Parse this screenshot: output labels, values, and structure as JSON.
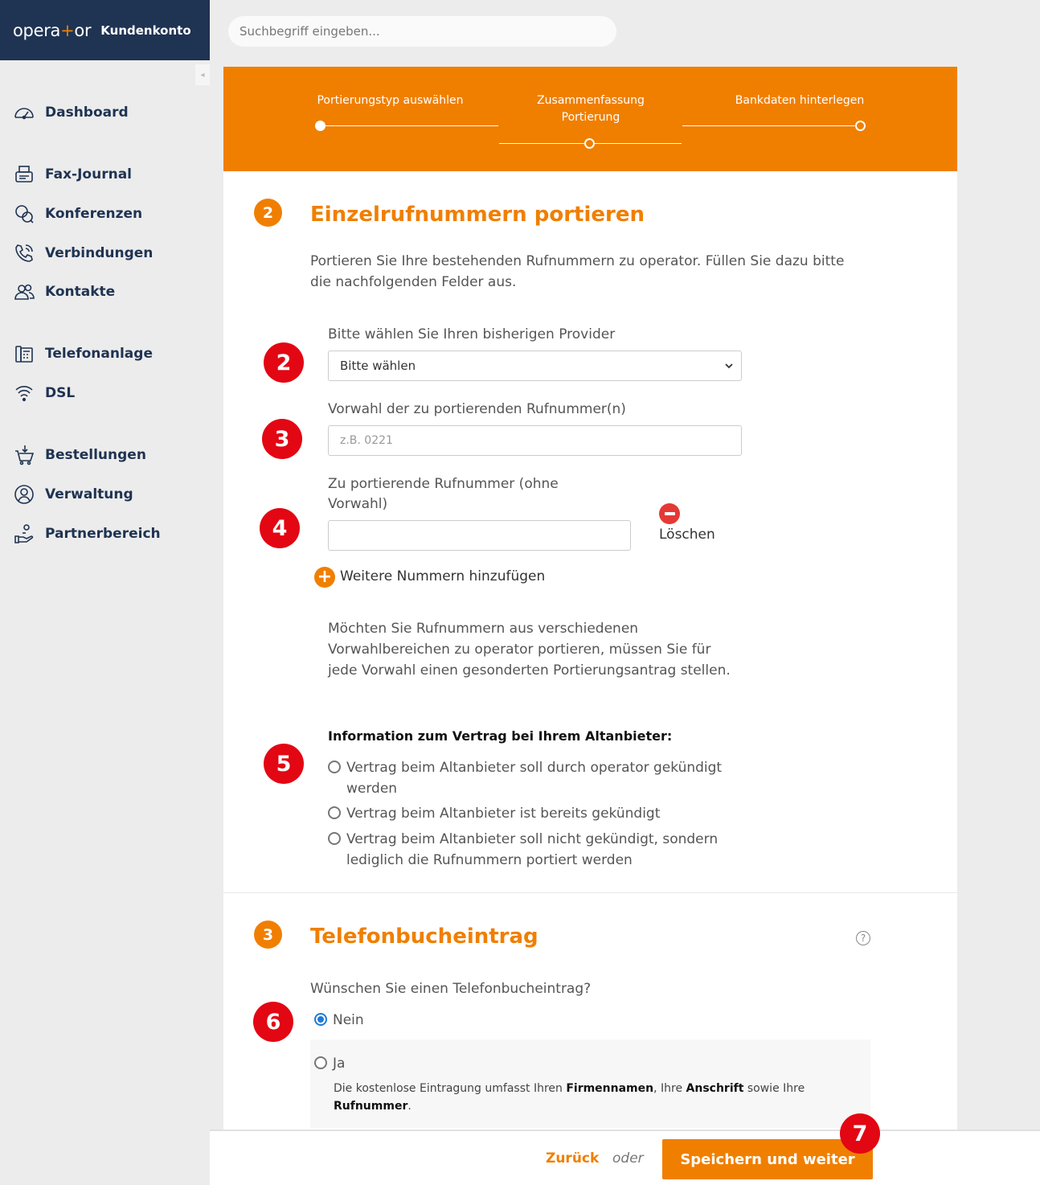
{
  "header": {
    "logo_left": "opera",
    "logo_plus": "+",
    "logo_right": "or",
    "account_label": "Kundenkonto",
    "search_placeholder": "Suchbegriff eingeben..."
  },
  "sidebar": {
    "collapse_glyph": "◂",
    "items": [
      {
        "label": "Dashboard",
        "icon": "speedometer-icon"
      },
      {
        "label": "Fax-Journal",
        "icon": "fax-icon"
      },
      {
        "label": "Konferenzen",
        "icon": "conference-chat-icon"
      },
      {
        "label": "Verbindungen",
        "icon": "phone-call-icon"
      },
      {
        "label": "Kontakte",
        "icon": "contacts-icon"
      },
      {
        "label": "Telefonanlage",
        "icon": "phone-system-icon"
      },
      {
        "label": "DSL",
        "icon": "wifi-icon"
      },
      {
        "label": "Bestellungen",
        "icon": "cart-icon"
      },
      {
        "label": "Verwaltung",
        "icon": "user-circle-icon"
      },
      {
        "label": "Partnerbereich",
        "icon": "partner-hand-icon"
      }
    ]
  },
  "steps": [
    {
      "label": "Portierungstyp auswählen"
    },
    {
      "label_line1": "Zusammenfassung",
      "label_line2": "Portierung"
    },
    {
      "label": "Bankdaten hinterlegen"
    }
  ],
  "section2": {
    "number": "2",
    "title": "Einzelrufnummern portieren",
    "intro": "Portieren Sie Ihre bestehenden Rufnummern zu operator. Füllen Sie dazu bitte die nachfolgenden Felder aus.",
    "provider_label": "Bitte wählen Sie Ihren bisherigen Provider",
    "provider_value": "Bitte wählen",
    "prefix_label": "Vorwahl der zu portierenden Rufnummer(n)",
    "prefix_placeholder": "z.B. 0221",
    "number_label": "Zu portierende Rufnummer (ohne Vorwahl)",
    "number_value": "",
    "delete_label": "Löschen",
    "add_label": "Weitere Nummern hinzufügen",
    "add_glyph": "+",
    "note": "Möchten Sie Rufnummern aus verschiedenen Vorwahlbereichen zu operator portieren, müssen Sie für jede Vorwahl einen gesonderten Portierungsantrag stellen.",
    "contract_label": "Information zum Vertrag bei Ihrem Altanbieter:",
    "contract_options": [
      "Vertrag beim Altanbieter soll durch operator gekündigt werden",
      "Vertrag beim Altanbieter ist bereits gekündigt",
      "Vertrag beim Altanbieter soll nicht gekündigt, sondern lediglich die Rufnummern portiert werden"
    ]
  },
  "section3": {
    "number": "3",
    "title": "Telefonbucheintrag",
    "help_glyph": "?",
    "question": "Wünschen Sie einen Telefonbucheintrag?",
    "option_no": "Nein",
    "option_yes": "Ja",
    "selected": "Nein",
    "desc_part1": "Die kostenlose Eintragung umfasst Ihren ",
    "desc_bold1": "Firmennamen",
    "desc_part2": ", Ihre ",
    "desc_bold2": "Anschrift",
    "desc_part3": " sowie Ihre ",
    "desc_bold3": "Rufnummer",
    "desc_part4": "."
  },
  "annotations": [
    "2",
    "3",
    "4",
    "5",
    "6",
    "7"
  ],
  "footer": {
    "back_label": "Zurück",
    "or_label": "oder",
    "save_label": "Speichern und weiter"
  },
  "colors": {
    "brand_navy": "#1f3352",
    "accent_orange": "#f07f00",
    "annotation_red": "#e30613",
    "radio_blue": "#1e7bd6"
  }
}
